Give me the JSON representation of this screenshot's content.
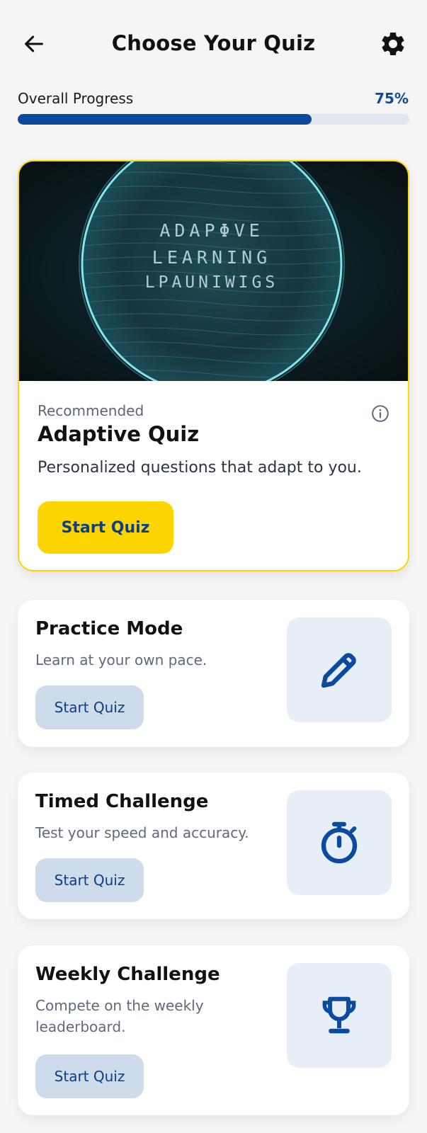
{
  "header": {
    "title": "Choose Your Quiz",
    "back_icon": "arrow-left-icon",
    "settings_icon": "gear-icon"
  },
  "progress": {
    "label": "Overall Progress",
    "value_text": "75%",
    "value": 0.75
  },
  "featured": {
    "badge": "Recommended",
    "title": "Adaptive Quiz",
    "description": "Personalized questions that adapt to you.",
    "button_label": "Start Quiz",
    "info_icon": "info-icon",
    "hero_text": [
      "ADAPΦVE",
      "LEARNING",
      "LPAUNIWIGS"
    ]
  },
  "modes": [
    {
      "title": "Practice Mode",
      "description": "Learn at your own pace.",
      "button_label": "Start Quiz",
      "icon": "pencil-icon"
    },
    {
      "title": "Timed Challenge",
      "description": "Test your speed and accuracy.",
      "button_label": "Start Quiz",
      "icon": "stopwatch-icon"
    },
    {
      "title": "Weekly Challenge",
      "description": "Compete on the weekly leaderboard.",
      "button_label": "Start Quiz",
      "icon": "trophy-icon"
    }
  ],
  "colors": {
    "accent": "#0b4a9c",
    "highlight": "#ffd500",
    "background": "#f5f5f5"
  }
}
